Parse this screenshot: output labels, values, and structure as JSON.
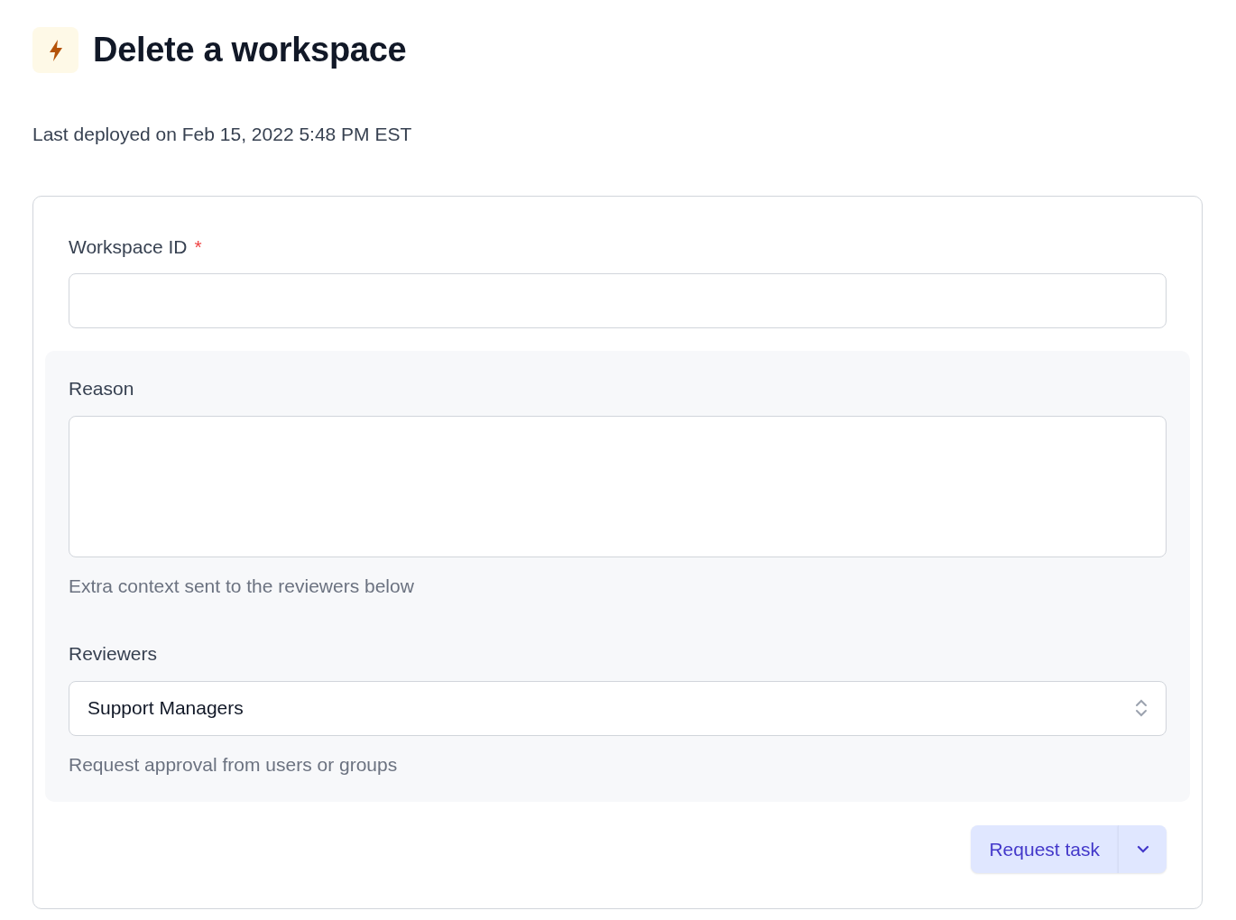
{
  "header": {
    "title": "Delete a workspace",
    "subtitle": "Last deployed on Feb 15, 2022 5:48 PM EST"
  },
  "form": {
    "fields": [
      {
        "kind": "text",
        "label": "Workspace ID",
        "required_mark": "*"
      }
    ],
    "review_section": {
      "fields": [
        {
          "kind": "textarea",
          "label": "Reason",
          "help": "Extra context sent to the reviewers below"
        },
        {
          "kind": "select",
          "label": "Reviewers",
          "value": "Support Managers",
          "help": "Request approval from users or groups"
        }
      ]
    },
    "submit": {
      "label": "Request task"
    }
  }
}
